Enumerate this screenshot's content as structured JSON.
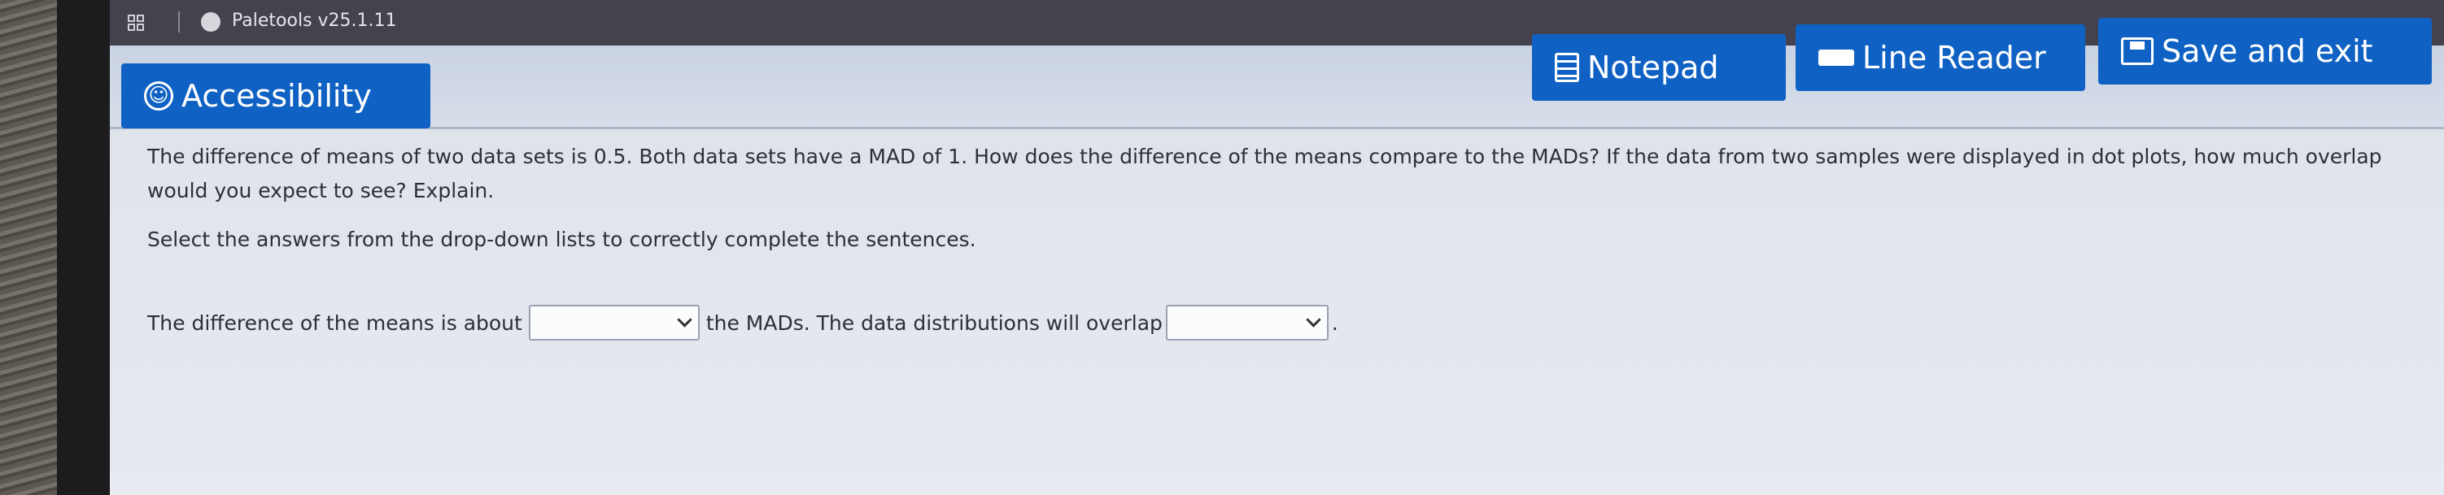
{
  "titlebar": {
    "app_title": "Paletools v25.1.11",
    "grid_icon": "grid-icon",
    "app_icon": "app-icon"
  },
  "toolbar": {
    "accessibility_label": "Accessibility",
    "notepad_label": "Notepad",
    "line_reader_label": "Line Reader",
    "save_exit_label": "Save and exit",
    "accent_color": "#0f62c4"
  },
  "question": {
    "text": "The difference of means of two data sets is 0.5. Both data sets have a MAD of 1. How does the difference of the means compare to the MADs? If the data from two samples were displayed in dot plots, how much overlap would you expect to see? Explain.",
    "instruction": "Select the answers from the drop-down lists to correctly complete the sentences.",
    "sentence_part1": "The difference of the means is about",
    "sentence_part2": "the MADs. The data distributions will overlap",
    "sentence_end": ".",
    "dropdown1_value": "",
    "dropdown2_value": ""
  }
}
